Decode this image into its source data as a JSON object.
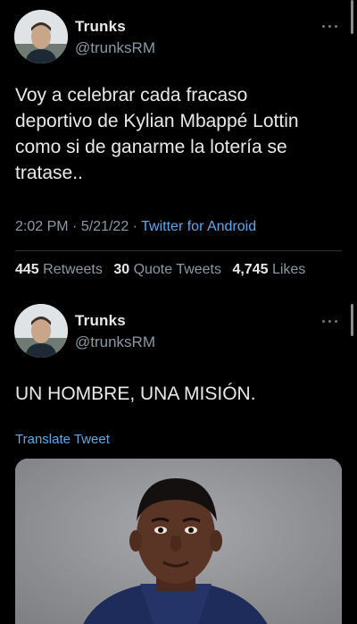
{
  "tweet1": {
    "author": {
      "name": "Trunks",
      "handle": "@trunksRM"
    },
    "text_lines": [
      "Voy a celebrar cada fracaso",
      "deportivo de Kylian Mbappé Lottin",
      "como si de ganarme la lotería se",
      "tratase.."
    ],
    "time": "2:02 PM",
    "date": "5/21/22",
    "source": "Twitter for Android",
    "stats": {
      "retweets_count": "445",
      "retweets_label": "Retweets",
      "quotes_count": "30",
      "quotes_label": "Quote Tweets",
      "likes_count": "4,745",
      "likes_label": "Likes"
    }
  },
  "tweet2": {
    "author": {
      "name": "Trunks",
      "handle": "@trunksRM"
    },
    "text": "UN HOMBRE, UNA MISIÓN.",
    "translate_label": "Translate Tweet",
    "media_icon": "photo-of-player"
  },
  "colors": {
    "background": "#000000",
    "text": "#e7e9ea",
    "secondary": "#8b98a5",
    "link": "#5fa8e8"
  }
}
